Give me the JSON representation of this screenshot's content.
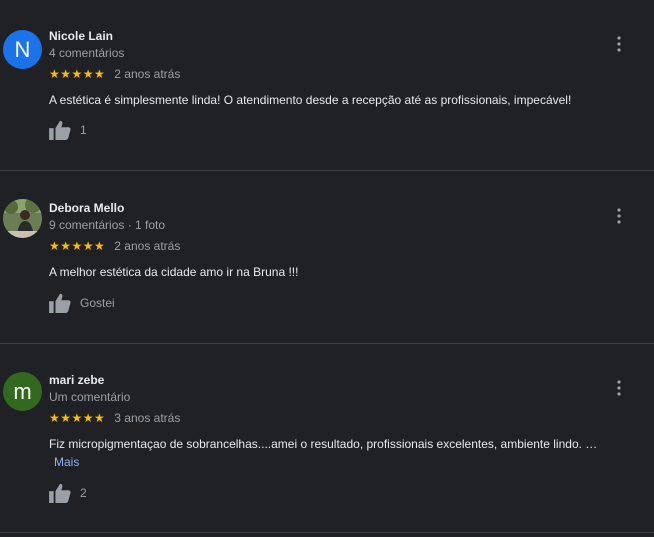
{
  "reviews": [
    {
      "avatar_letter": "N",
      "avatar_color": "#1a73e8",
      "name": "Nicole Lain",
      "meta": "4 comentários",
      "stars": "★★★★★",
      "date": "2 anos atrás",
      "text": "A estética é simplesmente linda! O atendimento desde a recepção  até as profissionais, impecável!",
      "like_label": "1"
    },
    {
      "avatar_letter": "",
      "name": "Debora Mello",
      "meta": "9 comentários · 1 foto",
      "stars": "★★★★★",
      "date": "2 anos atrás",
      "text": "A melhor estética da cidade amo ir na Bruna !!!",
      "like_label": "Gostei"
    },
    {
      "avatar_letter": "m",
      "avatar_color": "#33691e",
      "name": "mari zebe",
      "meta": "Um comentário",
      "stars": "★★★★★",
      "date": "3 anos atrás",
      "text": "Fiz micropigmentaçao de sobrancelhas....amei o resultado, profissionais excelentes, ambiente lindo. …",
      "more_label": "Mais",
      "like_label": "2"
    }
  ],
  "colors": {
    "background": "#202124",
    "star": "#fbbc04",
    "link": "#8ab4f8"
  }
}
